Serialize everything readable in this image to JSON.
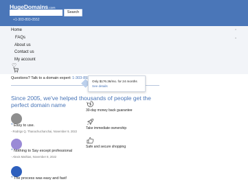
{
  "header": {
    "logo_main": "HugeDomains",
    "logo_suffix": ".com",
    "search_placeholder": "",
    "search_label": "Search",
    "phone": "+1-303-893-0552"
  },
  "menu": {
    "items": [
      "Home",
      "FAQs",
      "About us",
      "Contact us",
      "My account"
    ]
  },
  "question": {
    "text": "Questions? Talk to a domain expert: ",
    "phone": "1-303-893-0552"
  },
  "tooltip": {
    "text": "Only $176.36/mo. for 24 months ",
    "link": "See details"
  },
  "headline": "Since 2005, we've helped thousands of people get the perfect domain name",
  "reviews": [
    {
      "quote": "Easy to use.",
      "author": "- Rodrigo Q. Thanachuchanchai, November 9, 2022"
    },
    {
      "quote": "Nothing to Say except professional",
      "author": "- Alexis Mathias, November 8, 2022"
    },
    {
      "quote": "The process was easy and fast!",
      "author": ""
    }
  ],
  "features": [
    {
      "label": "30-day money back guarantee",
      "icon": "refund-icon"
    },
    {
      "label": "Take immediate ownership",
      "icon": "rocket-icon"
    },
    {
      "label": "Safe and secure shopping",
      "icon": "thumbs-up-icon"
    }
  ],
  "colors": {
    "brand_blue": "#4a76b8",
    "menu_bg": "#f2f4f8"
  }
}
